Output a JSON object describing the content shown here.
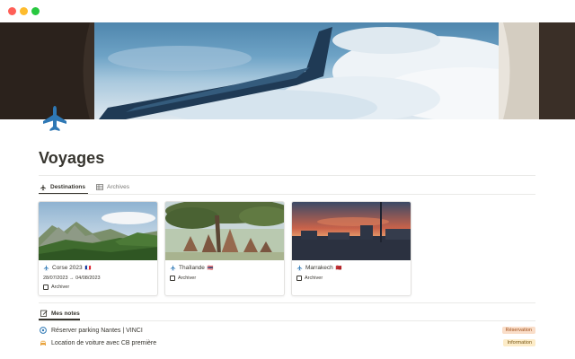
{
  "page": {
    "title": "Voyages",
    "icon": "airplane-icon"
  },
  "tabs": [
    {
      "label": "Destinations",
      "icon": "airplane-icon",
      "active": true
    },
    {
      "label": "Archives",
      "icon": "table-icon",
      "active": false
    }
  ],
  "cards": [
    {
      "title": "Corse 2023",
      "flag": "🇫🇷",
      "dates": "28/07/2023 → 04/08/2023",
      "checkbox_label": "Archiver",
      "checked": false
    },
    {
      "title": "Thaïlande",
      "flag": "🇹🇭",
      "dates": "",
      "checkbox_label": "Archiver",
      "checked": false
    },
    {
      "title": "Marrakech",
      "flag": "🇲🇦",
      "dates": "",
      "checkbox_label": "Archiver",
      "checked": false
    }
  ],
  "notes": {
    "tab_label": "Mes notes",
    "items": [
      {
        "label": "Réserver parking Nantes | VINCI",
        "icon": "parking-icon",
        "tag": "Réservation",
        "tag_color": "#fadec9",
        "tag_text_color": "#9f4f1a"
      },
      {
        "label": "Location de voiture avec CB première",
        "icon": "car-icon",
        "tag": "Information",
        "tag_color": "#fdecc8",
        "tag_text_color": "#7a5a17"
      }
    ]
  },
  "colors": {
    "accent_blue": "#2e78b5",
    "text": "#37352f",
    "muted": "#787774"
  }
}
